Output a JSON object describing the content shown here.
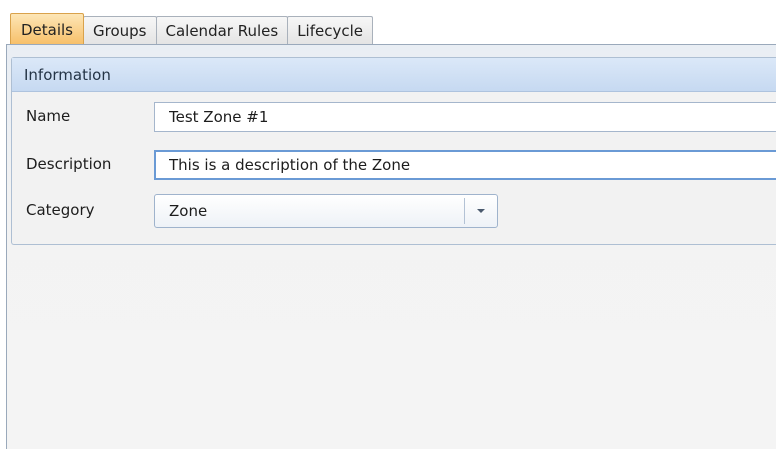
{
  "tabs": [
    {
      "label": "Details",
      "active": true
    },
    {
      "label": "Groups",
      "active": false
    },
    {
      "label": "Calendar Rules",
      "active": false
    },
    {
      "label": "Lifecycle",
      "active": false
    }
  ],
  "group": {
    "title": "Information"
  },
  "form": {
    "name_label": "Name",
    "name_value": "Test Zone #1",
    "description_label": "Description",
    "description_value": "This is a description of the Zone",
    "category_label": "Category",
    "category_value": "Zone"
  },
  "colors": {
    "active_tab": "#f7c06a",
    "header": "#c6d9f1",
    "focus_border": "#6a9ad5"
  },
  "icons": {
    "combo_arrow": "chevron-down-icon"
  }
}
